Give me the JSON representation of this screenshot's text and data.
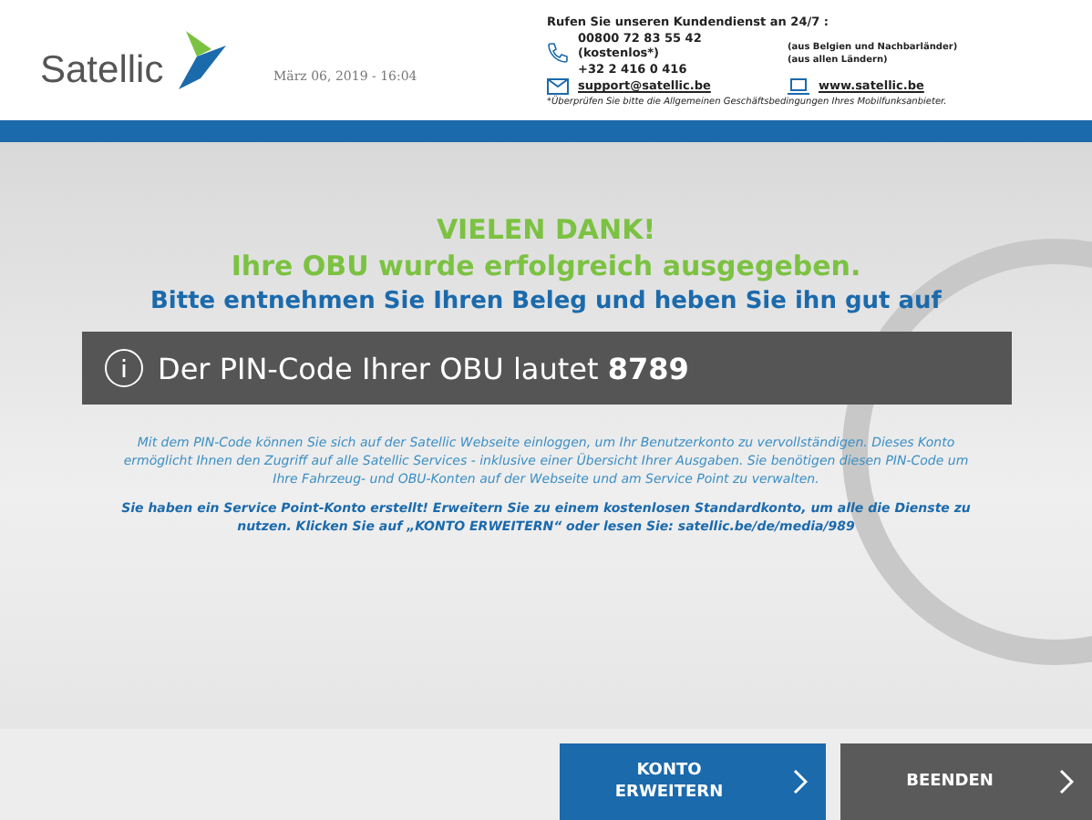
{
  "header": {
    "logo": "Satellic",
    "datetime": "März 06, 2019 - 16:04",
    "contact_title": "Rufen Sie unseren Kundendienst an 24/7 :",
    "phones": [
      {
        "number": "00800 72 83 55 42 (kostenlos*)",
        "note": "(aus Belgien und Nachbarländer)"
      },
      {
        "number": "+32 2 416 0 416",
        "note": "(aus allen Ländern)"
      }
    ],
    "email": "support@satellic.be",
    "website": "www.satellic.be",
    "footnote": "*Überprüfen Sie bitte die Allgemeinen Geschäftsbedingungen Ihres Mobilfunksanbieter."
  },
  "main": {
    "thanks": "VIELEN DANK!",
    "issued": "Ihre OBU wurde erfolgreich ausgegeben.",
    "receipt": "Bitte entnehmen Sie Ihren Beleg und heben Sie ihn gut auf",
    "pin_message": "Der PIN-Code Ihrer OBU lautet **8789**",
    "info": "Mit dem PIN-Code können Sie sich auf der Satellic Webseite einloggen, um Ihr Benutzerkonto zu vervollständigen. Dieses Konto ermöglicht Ihnen den Zugriff auf alle Satellic Services - inklusive einer Übersicht Ihrer Ausgaben. Sie benötigen diesen PIN-Code um Ihre Fahrzeug- und OBU-Konten auf der Webseite und am Service Point zu verwalten.",
    "notice": "Sie haben ein Service Point-Konto erstellt! Erweitern Sie zu einem kostenlosen Standardkonto, um alle die Dienste zu nutzen. Klicken Sie auf „KONTO ERWEITERN“ oder lesen Sie: satellic.be/de/media/989"
  },
  "buttons": [
    {
      "label": "KONTO ERWEITERN",
      "kind": "primary"
    },
    {
      "label": "BEENDEN",
      "kind": "secondary"
    }
  ]
}
